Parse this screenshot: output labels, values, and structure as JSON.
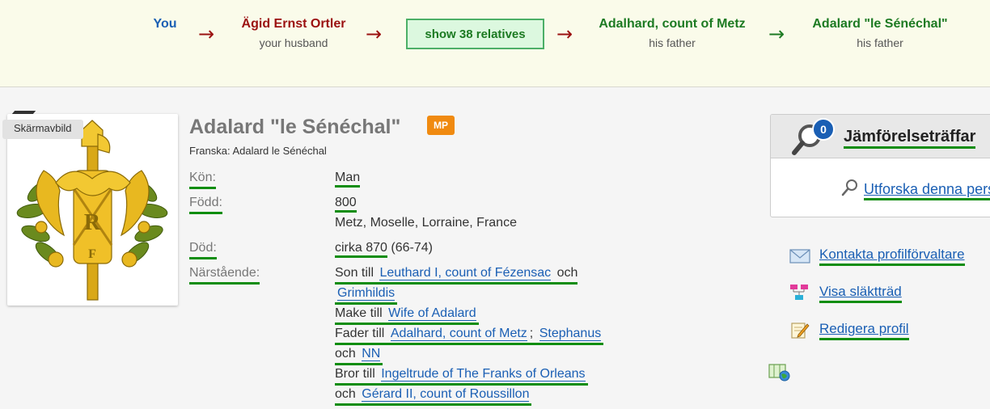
{
  "relationship_path": {
    "nodes": [
      {
        "name": "You",
        "sub": ""
      },
      {
        "name": "Ägid Ernst Ortler",
        "sub": "your husband"
      },
      {
        "name": "Adalhard, count of Metz",
        "sub": "his father"
      },
      {
        "name": "Adalard \"le Sénéchal\"",
        "sub": "his father"
      }
    ],
    "show_relatives": "show 38 relatives",
    "arrow": "→",
    "colors": {
      "you": "#1a5fb4",
      "husband": "#9b1010",
      "ancestor": "#1c7a22"
    }
  },
  "photo": {
    "label": "Skärmavbild",
    "image": "french-coat-of-arms-fasces-emblem"
  },
  "profile": {
    "name": "Adalard \"le Sénéchal\"",
    "badge": "MP",
    "alt_name": "Franska: Adalard le Sénéchal",
    "fields": {
      "gender": {
        "label": "Kön:",
        "value": "Man"
      },
      "born": {
        "label": "Född:",
        "date": "800",
        "place": "Metz, Moselle, Lorraine, France"
      },
      "died": {
        "label": "Död:",
        "date": "cirka 870",
        "age": "(66-74)"
      },
      "relatives": {
        "label": "Närstående:"
      }
    },
    "relations": {
      "son_of": {
        "prefix": "Son till",
        "parent1": "Leuthard I, count of Fézensac",
        "conj": "och",
        "parent2": "Grimhildis"
      },
      "husband_of": {
        "prefix": "Make till",
        "spouse": "Wife of Adalard"
      },
      "father_of": {
        "prefix": "Fader till",
        "child1": "Adalhard, count of Metz",
        "sep": ";",
        "child2": "Stephanus",
        "conj": "och",
        "child3": "NN"
      },
      "brother_of": {
        "prefix": "Bror till",
        "sib1": "Ingeltrude of The Franks of Orleans",
        "conj": "och",
        "sib2": "Gérard II, count of Roussillon"
      }
    }
  },
  "sidebar": {
    "match_title": "Jämförelseträffar",
    "match_count": "0",
    "explore": "Utforska denna person",
    "actions": {
      "contact": "Kontakta profilförvaltare",
      "tree": "Visa släktträd",
      "edit": "Redigera profil"
    }
  }
}
